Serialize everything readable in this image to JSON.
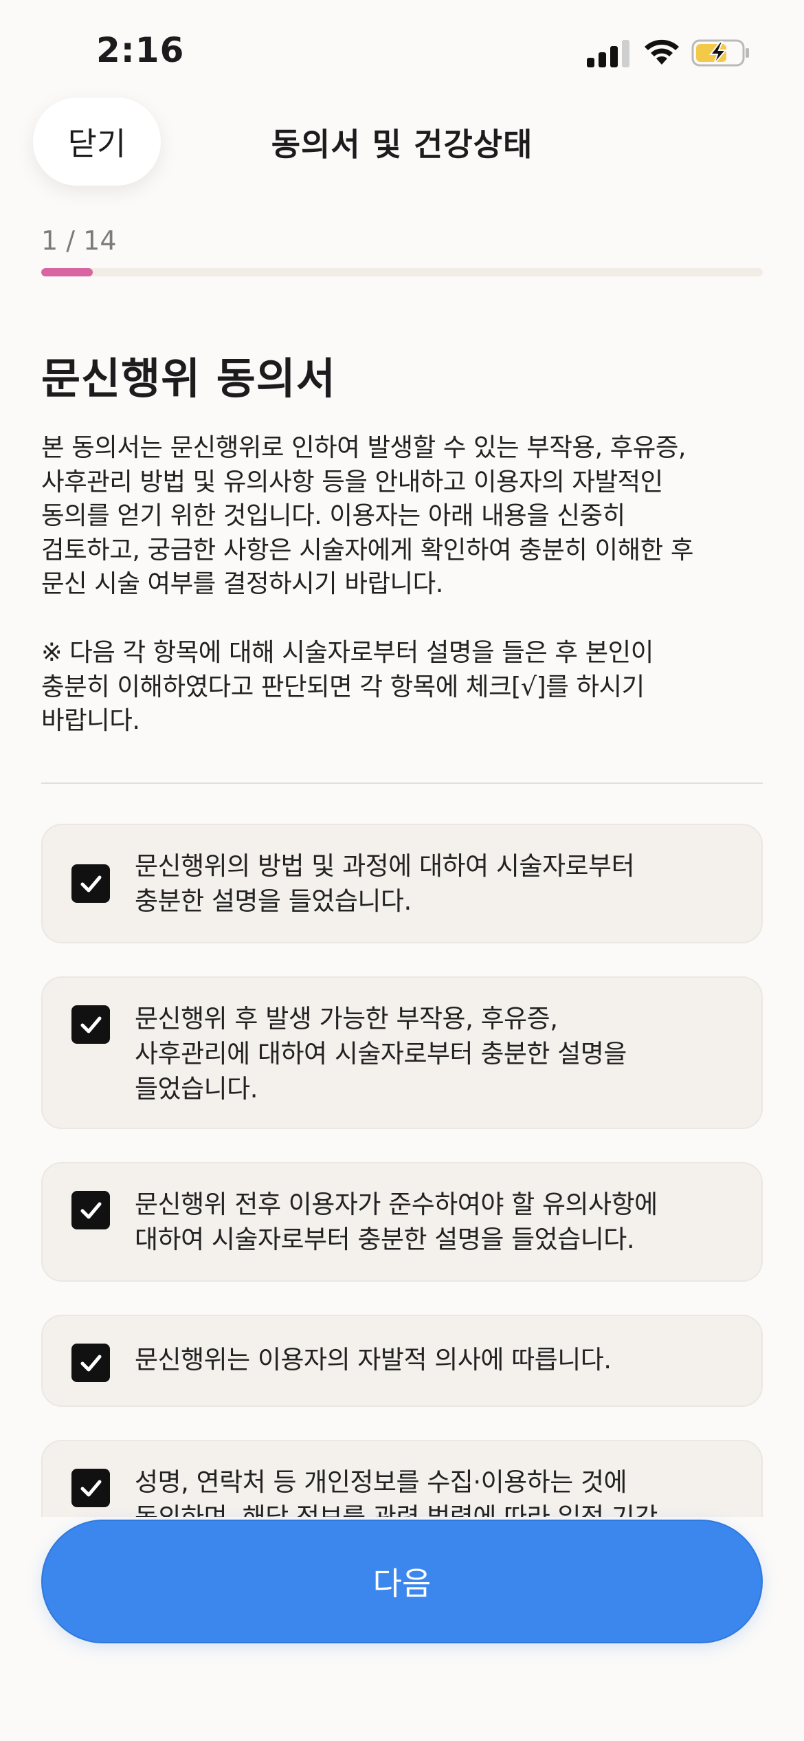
{
  "status_bar": {
    "time": "2:16",
    "icons": [
      "cellular-signal-icon",
      "wifi-icon",
      "battery-charging-icon"
    ]
  },
  "header": {
    "close_label": "닫기",
    "title": "동의서 및 건강상태"
  },
  "progress": {
    "label": "1 / 14",
    "current": 1,
    "total": 14,
    "fill_color": "#d864a2"
  },
  "consent": {
    "heading": "문신행위 동의서",
    "intro": "본 동의서는 문신행위로 인하여 발생할 수 있는 부작용, 후유증,\n사후관리 방법 및 유의사항 등을 안내하고 이용자의 자발적인\n동의를 얻기 위한 것입니다. 이용자는 아래 내용을 신중히\n검토하고, 궁금한 사항은 시술자에게 확인하여 충분히 이해한 후\n문신 시술 여부를 결정하시기 바랍니다.",
    "notice": "※ 다음 각 항목에 대해 시술자로부터 설명을 들은 후 본인이\n충분히 이해하였다고 판단되면 각 항목에 체크[√]를 하시기\n바랍니다.",
    "items": [
      {
        "text": "문신행위의 방법 및 과정에 대하여 시술자로부터\n충분한 설명을 들었습니다.",
        "checked": true
      },
      {
        "text": "문신행위 후 발생 가능한 부작용, 후유증,\n사후관리에 대하여 시술자로부터 충분한 설명을\n들었습니다.",
        "checked": true
      },
      {
        "text": "문신행위 전후 이용자가 준수하여야 할 유의사항에\n대하여 시술자로부터 충분한 설명을 들었습니다.",
        "checked": true
      },
      {
        "text": "문신행위는 이용자의 자발적 의사에 따릅니다.",
        "checked": true
      },
      {
        "text": "성명, 연락처 등 개인정보를 수집·이용하는 것에\n동의하며, 해당 정보를 관련 법령에 따라 일정 기간",
        "checked": true
      }
    ]
  },
  "footer": {
    "next_label": "다음",
    "accent_color": "#3b87ee"
  }
}
